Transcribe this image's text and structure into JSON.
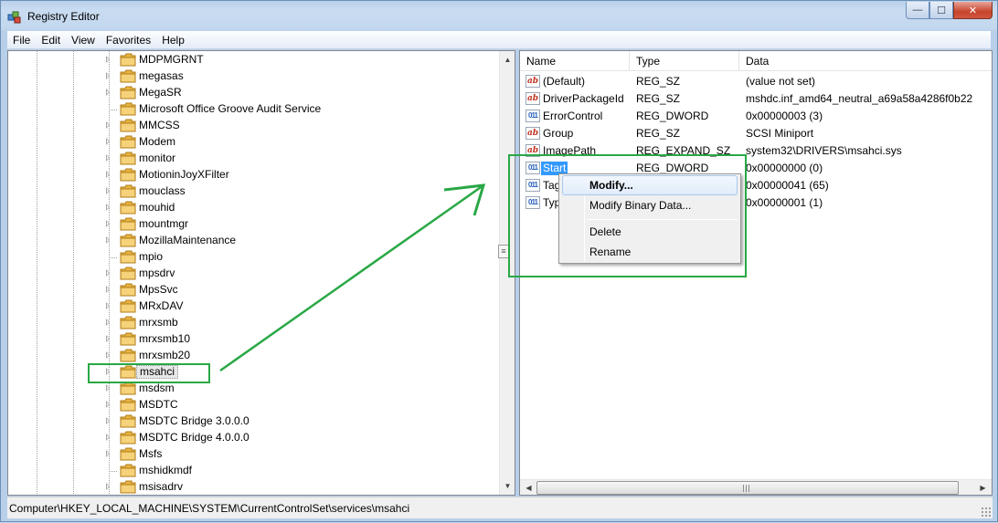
{
  "window": {
    "title": "Registry Editor",
    "caption_buttons": {
      "minimize": "—",
      "maximize": "☐",
      "close": "✕"
    }
  },
  "menu": [
    "File",
    "Edit",
    "View",
    "Favorites",
    "Help"
  ],
  "tree": {
    "items": [
      {
        "label": "MDPMGRNT",
        "expandable": true
      },
      {
        "label": "megasas",
        "expandable": true
      },
      {
        "label": "MegaSR",
        "expandable": true
      },
      {
        "label": "Microsoft Office Groove Audit Service",
        "expandable": false
      },
      {
        "label": "MMCSS",
        "expandable": true
      },
      {
        "label": "Modem",
        "expandable": true
      },
      {
        "label": "monitor",
        "expandable": true
      },
      {
        "label": "MotioninJoyXFilter",
        "expandable": true
      },
      {
        "label": "mouclass",
        "expandable": true
      },
      {
        "label": "mouhid",
        "expandable": true
      },
      {
        "label": "mountmgr",
        "expandable": true
      },
      {
        "label": "MozillaMaintenance",
        "expandable": true
      },
      {
        "label": "mpio",
        "expandable": false
      },
      {
        "label": "mpsdrv",
        "expandable": true
      },
      {
        "label": "MpsSvc",
        "expandable": true
      },
      {
        "label": "MRxDAV",
        "expandable": true
      },
      {
        "label": "mrxsmb",
        "expandable": true
      },
      {
        "label": "mrxsmb10",
        "expandable": true
      },
      {
        "label": "mrxsmb20",
        "expandable": true
      },
      {
        "label": "msahci",
        "expandable": true,
        "selected": true
      },
      {
        "label": "msdsm",
        "expandable": true
      },
      {
        "label": "MSDTC",
        "expandable": true
      },
      {
        "label": "MSDTC Bridge 3.0.0.0",
        "expandable": true
      },
      {
        "label": "MSDTC Bridge 4.0.0.0",
        "expandable": true
      },
      {
        "label": "Msfs",
        "expandable": true
      },
      {
        "label": "mshidkmdf",
        "expandable": false
      },
      {
        "label": "msisadrv",
        "expandable": true
      }
    ],
    "scroll_up": "▲",
    "scroll_down": "▼",
    "splitter": "≡"
  },
  "list": {
    "columns": {
      "name": "Name",
      "type": "Type",
      "data": "Data"
    },
    "rows": [
      {
        "icon": "string-value-icon",
        "icon_text": "ab",
        "name": "(Default)",
        "type": "REG_SZ",
        "data": "(value not set)"
      },
      {
        "icon": "string-value-icon",
        "icon_text": "ab",
        "name": "DriverPackageId",
        "type": "REG_SZ",
        "data": "mshdc.inf_amd64_neutral_a69a58a4286f0b22"
      },
      {
        "icon": "dword-value-icon",
        "icon_text": "011",
        "name": "ErrorControl",
        "type": "REG_DWORD",
        "data": "0x00000003 (3)"
      },
      {
        "icon": "string-value-icon",
        "icon_text": "ab",
        "name": "Group",
        "type": "REG_SZ",
        "data": "SCSI Miniport"
      },
      {
        "icon": "string-value-icon",
        "icon_text": "ab",
        "name": "ImagePath",
        "type": "REG_EXPAND_SZ",
        "data": "system32\\DRIVERS\\msahci.sys"
      },
      {
        "icon": "dword-value-icon",
        "icon_text": "011",
        "name": "Start",
        "type": "REG_DWORD",
        "data": "0x00000000 (0)",
        "selected": true
      },
      {
        "icon": "dword-value-icon",
        "icon_text": "011",
        "name": "Tag",
        "type": "",
        "data": "0x00000041 (65)"
      },
      {
        "icon": "dword-value-icon",
        "icon_text": "011",
        "name": "Type",
        "type": "",
        "data": "0x00000001 (1)"
      }
    ],
    "scroll_left": "◀",
    "scroll_right": "▶"
  },
  "context_menu": {
    "items": [
      "Modify...",
      "Modify Binary Data...",
      "Delete",
      "Rename"
    ]
  },
  "status": {
    "path": "Computer\\HKEY_LOCAL_MACHINE\\SYSTEM\\CurrentControlSet\\services\\msahci"
  },
  "colors": {
    "annotation": "#29a846",
    "selection": "#3399ff",
    "folder": "#f1c55f"
  }
}
